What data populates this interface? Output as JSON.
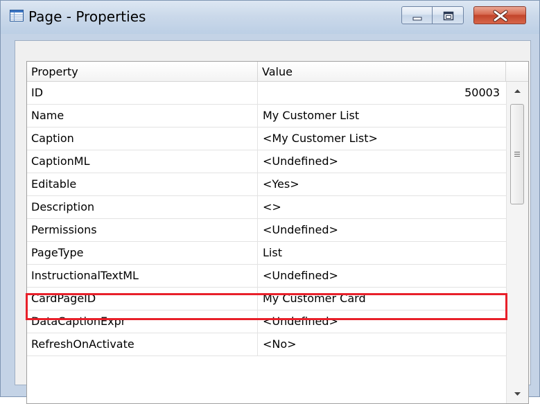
{
  "window": {
    "title": "Page - Properties",
    "icon": "table-icon",
    "buttons": {
      "minimize": "minimize-icon",
      "maximize": "maximize-icon",
      "close": "close-icon"
    }
  },
  "grid": {
    "columns": {
      "property": "Property",
      "value": "Value"
    },
    "rows": [
      {
        "property": "ID",
        "value": "50003"
      },
      {
        "property": "Name",
        "value": "My Customer List"
      },
      {
        "property": "Caption",
        "value": "<My Customer List>"
      },
      {
        "property": "CaptionML",
        "value": "<Undefined>"
      },
      {
        "property": "Editable",
        "value": "<Yes>"
      },
      {
        "property": "Description",
        "value": "<>"
      },
      {
        "property": "Permissions",
        "value": "<Undefined>"
      },
      {
        "property": "PageType",
        "value": "List"
      },
      {
        "property": "InstructionalTextML",
        "value": "<Undefined>"
      },
      {
        "property": "CardPageID",
        "value": "My Customer Card"
      },
      {
        "property": "DataCaptionExpr",
        "value": "<Undefined>"
      },
      {
        "property": "RefreshOnActivate",
        "value": "<No>"
      }
    ],
    "highlighted_row": "CardPageID",
    "highlight_color": "#e8202a"
  },
  "colors": {
    "titlebar": "#c4d3e6",
    "close_button": "#c2452b"
  }
}
